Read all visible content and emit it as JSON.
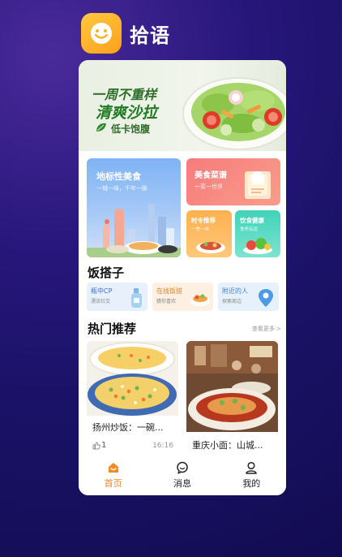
{
  "app": {
    "name": "拾语"
  },
  "banner": {
    "line1": "一周不重样",
    "line2": "清爽沙拉",
    "line3": "低卡饱腹"
  },
  "tiles": {
    "landmark": {
      "title": "地标性美食",
      "subtitle": "一城一味，千年一脉"
    },
    "recipes": {
      "title": "美食菜谱",
      "subtitle": "一菜一世界"
    },
    "seasonal": {
      "title": "时令推荐",
      "subtitle": "一季一味"
    },
    "health": {
      "title": "饮食健康",
      "subtitle": "食养有道"
    }
  },
  "fandazi": {
    "title": "饭搭子",
    "items": [
      {
        "title": "瓶中CP",
        "subtitle": "漂流社交"
      },
      {
        "title": "在线饭搭",
        "subtitle": "猜你喜欢"
      },
      {
        "title": "附近的人",
        "subtitle": "探索周边"
      }
    ]
  },
  "hot": {
    "title": "热门推荐",
    "more": "查看更多 >",
    "items": [
      {
        "title": "扬州炒饭：一碗...",
        "likes": "1",
        "time": "16:16"
      },
      {
        "title": "重庆小面：山城..."
      }
    ]
  },
  "tabbar": {
    "home": "首页",
    "messages": "消息",
    "mine": "我的"
  },
  "colors": {
    "accent": "#f08a24",
    "brand": "#ffb125"
  }
}
